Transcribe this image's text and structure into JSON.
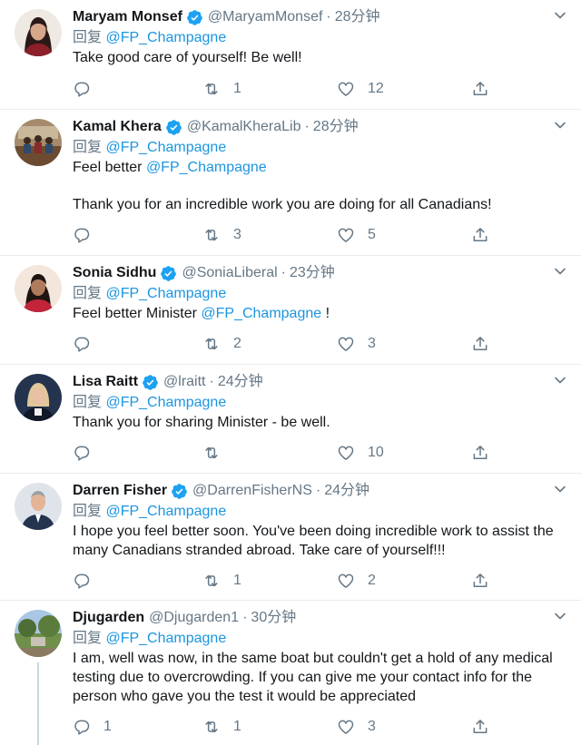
{
  "colors": {
    "accent": "#1b95e0",
    "muted": "#657786",
    "text": "#14171a",
    "border": "#e6ecf0"
  },
  "tweets": [
    {
      "name": "Maryam Monsef",
      "verified": true,
      "handle": "@MaryamMonsef",
      "time": "28分钟",
      "reply_prefix": "回复",
      "reply_to": "@FP_Champagne",
      "text_before": "Take good care of yourself! Be well!",
      "mention": "",
      "text_after": "",
      "extra": "",
      "replies": "",
      "retweets": "1",
      "likes": "12"
    },
    {
      "name": "Kamal Khera",
      "verified": true,
      "handle": "@KamalKheraLib",
      "time": "28分钟",
      "reply_prefix": "回复",
      "reply_to": "@FP_Champagne",
      "text_before": "Feel better ",
      "mention": "@FP_Champagne",
      "text_after": "",
      "extra": "Thank you for an incredible work you are doing for all Canadians!",
      "replies": "",
      "retweets": "3",
      "likes": "5"
    },
    {
      "name": "Sonia Sidhu",
      "verified": true,
      "handle": "@SoniaLiberal",
      "time": "23分钟",
      "reply_prefix": "回复",
      "reply_to": "@FP_Champagne",
      "text_before": "Feel better Minister ",
      "mention": "@FP_Champagne",
      "text_after": " !",
      "extra": "",
      "replies": "",
      "retweets": "2",
      "likes": "3"
    },
    {
      "name": "Lisa Raitt",
      "verified": true,
      "handle": "@lraitt",
      "time": "24分钟",
      "reply_prefix": "回复",
      "reply_to": "@FP_Champagne",
      "text_before": "Thank you for sharing Minister - be well.",
      "mention": "",
      "text_after": "",
      "extra": "",
      "replies": "",
      "retweets": "",
      "likes": "10"
    },
    {
      "name": "Darren Fisher",
      "verified": true,
      "handle": "@DarrenFisherNS",
      "time": "24分钟",
      "reply_prefix": "回复",
      "reply_to": "@FP_Champagne",
      "text_before": "I hope you feel better soon. You've been doing incredible work to assist the many Canadians stranded abroad. Take care of yourself!!!",
      "mention": "",
      "text_after": "",
      "extra": "",
      "replies": "",
      "retweets": "1",
      "likes": "2"
    },
    {
      "name": "Djugarden",
      "verified": false,
      "handle": "@Djugarden1",
      "time": "30分钟",
      "reply_prefix": "回复",
      "reply_to": "@FP_Champagne",
      "text_before": "I am, well was now, in the same boat but couldn't get a hold of any medical testing due to overcrowding. If you can give me your contact info for the person who gave you the test it would be appreciated",
      "mention": "",
      "text_after": "",
      "extra": "",
      "replies": "1",
      "retweets": "1",
      "likes": "3"
    }
  ]
}
